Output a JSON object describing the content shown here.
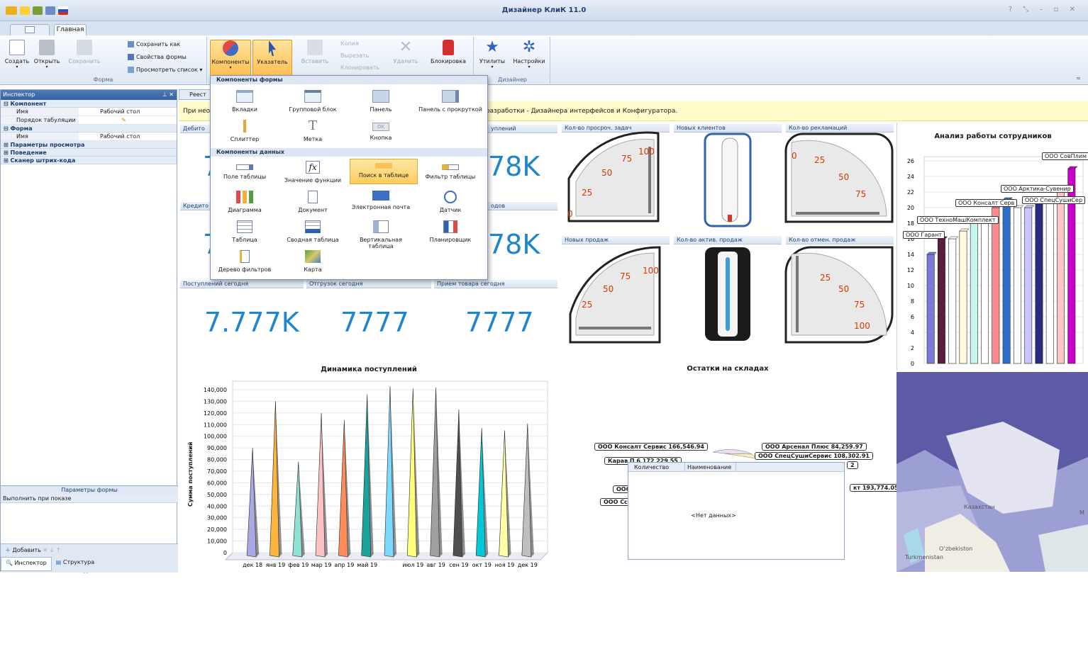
{
  "window": {
    "title": "Дизайнер КлиК 11.0"
  },
  "tabs": {
    "home": "Главная"
  },
  "ribbon": {
    "create": "Создать",
    "open": "Открыть",
    "save": "Сохранить",
    "save_as": "Сохранить как",
    "form_props": "Свойства формы",
    "view_list": "Просмотреть список",
    "form_group": "Форма",
    "components": "Компоненты",
    "pointer": "Указатель",
    "paste": "Вставить",
    "copy": "Копия",
    "cut": "Вырезать",
    "clone": "Клонировать",
    "delete": "Удалить",
    "lock": "Блокировка",
    "utilities": "Утилиты",
    "settings": "Настройки",
    "designer_group": "Дизайнер"
  },
  "inspector": {
    "title": "Инспектор",
    "cat_component": "Компонент",
    "name_key": "Имя",
    "name_val": "Рабочий стол",
    "tab_order": "Порядок табуляции",
    "cat_form": "Форма",
    "form_name_key": "Имя",
    "form_name_val": "Рабочий стол",
    "view_params": "Параметры просмотра",
    "behavior": "Поведение",
    "barcode": "Сканер штрих-кода",
    "params_title": "Параметры формы",
    "run_on_show": "Выполнить при показе",
    "no_data": "<Нет данных>",
    "add": "Добавить",
    "tab_inspector": "Инспектор",
    "tab_structure": "Структура"
  },
  "doc_tab": "Реест",
  "notice": "При нео                                                                                                                                     в разработки - Дизайнера интерфейсов и Конфигуратора.",
  "popup": {
    "form_section": "Компоненты формы",
    "data_section": "Компоненты данных",
    "form_items": [
      "Вкладки",
      "Групповой блок",
      "Панель",
      "Панель с прокруткой",
      "Сплиттер",
      "Метка",
      "Кнопка"
    ],
    "button_caption": "OK",
    "data_items": [
      "Поле таблицы",
      "Значение функции",
      "Поиск в таблице",
      "Фильтр таблицы",
      "Диаграмма",
      "Документ",
      "Электронная почта",
      "Датчик",
      "Таблица",
      "Сводная таблица",
      "Вертикальная таблица",
      "Планировщик",
      "Дерево фильтров",
      "Карта"
    ]
  },
  "kpi": {
    "debit_title": "Дебито",
    "receipts_title": "уплений",
    "credit_title": "Кредито",
    "writeoff_title": "одов",
    "n1": "7",
    "n2": "78K",
    "n3": "7",
    "n4": "78K",
    "today_receipts": "Поступлений сегодня",
    "today_ship": "Отгрузок сегодня",
    "today_accept": "Прием товара сегодня",
    "v1": "7.777K",
    "v2": "7777",
    "v3": "7777"
  },
  "gauges": {
    "t1": "Кол-во просроч. задач",
    "t2": "Новых клиентов",
    "t3": "Кол-во рекламаций",
    "t4": "Новых продаж",
    "t5": "Кол-во актив. продаж",
    "t6": "Кол-во отмен. продаж",
    "g1": [
      "0",
      "25",
      "50",
      "75",
      "100"
    ],
    "g3": [
      "0",
      "25",
      "50",
      "75"
    ],
    "g4": [
      "25",
      "50",
      "75",
      "100"
    ],
    "g6": [
      "25",
      "50",
      "75",
      "100"
    ],
    "therm": [
      "100",
      "80",
      "60",
      "40",
      "20",
      "0"
    ]
  },
  "chart_data": [
    {
      "type": "bar",
      "title": "Динамика поступлений",
      "ylabel": "Сумма поступлений",
      "ylim": [
        0,
        140000
      ],
      "yticks": [
        "140,000",
        "130,000",
        "120,000",
        "110,000",
        "100,000",
        "90,000",
        "80,000",
        "70,000",
        "60,000",
        "50,000",
        "40,000",
        "30,000",
        "20,000",
        "10,000",
        "0"
      ],
      "categories": [
        "дек 18",
        "янв 19",
        "фев 19",
        "мар 19",
        "апр 19",
        "май 19",
        "",
        "июл 19",
        "авг 19",
        "сен 19",
        "окт 19",
        "ноя 19",
        "дек 19"
      ],
      "values": [
        90000,
        130000,
        78000,
        120000,
        114000,
        136000,
        143000,
        141000,
        142000,
        123000,
        107000,
        105000,
        111000
      ],
      "colors": [
        "#a9a9e3",
        "#ffb43c",
        "#8fe1d6",
        "#ffc2c2",
        "#ff8c5a",
        "#1aa39a",
        "#7cd9ff",
        "#ffff7a",
        "#a0a0a0",
        "#4f4f4f",
        "#00c8d6",
        "#ffffa8",
        "#bfbfbf"
      ]
    },
    {
      "type": "bar",
      "title": "Анализ работы сотрудников",
      "ylim": [
        0,
        26
      ],
      "yticks": [
        "26",
        "24",
        "22",
        "20",
        "18",
        "16",
        "14",
        "12",
        "10",
        "8",
        "6",
        "4",
        "2",
        "0"
      ],
      "values": [
        14,
        16,
        16,
        17,
        18,
        18,
        20,
        21,
        20,
        20,
        21,
        21,
        22,
        25
      ],
      "colors": [
        "#7a7ad9",
        "#5a1e3d",
        "#ffffff",
        "#fffce0",
        "#c5f5f0",
        "#fff",
        "#ff8c8c",
        "#2c6fc8",
        "#fff",
        "#c8c8ff",
        "#2a2a80",
        "#ffffff",
        "#ffc4c4",
        "#c800c8"
      ],
      "annotations": [
        "ООО Гарант",
        "ООО ТехноМашКомплект",
        "ООО Консалт Серв",
        "ООО Арктика-Сувенир",
        "ООО СпецСушиСер",
        "ООО СовПлим"
      ]
    },
    {
      "type": "pie",
      "title": "Остатки на складах",
      "labels": [
        "ООО Консалт Сервис 166,546.94",
        "ООО Арсенал Плюс 84,259.97",
        "ООО СпецСушиСервис 108,302.91",
        "Карав   П  6 172 229 55",
        "кт 193,774.05",
        "ООО",
        "ООО Сс",
        "2"
      ]
    }
  ],
  "data_table": {
    "col1": "Количество",
    "col2": "Наименование",
    "no_data": "<Нет данных>"
  },
  "map": {
    "kazakhstan": "Казахстан",
    "uzbekistan": "O‘zbekiston",
    "turkmenistan": "Turkmenistan",
    "letter": "M"
  }
}
